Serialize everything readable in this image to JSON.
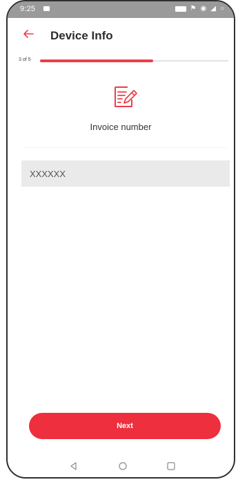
{
  "status_bar": {
    "time": "9:25"
  },
  "header": {
    "title": "Device Info"
  },
  "progress": {
    "label": "3 of 5",
    "fraction": 0.6
  },
  "section": {
    "label": "Invoice number"
  },
  "invoice_input": {
    "value": "XXXXXX"
  },
  "actions": {
    "next_label": "Next"
  },
  "colors": {
    "accent": "#ee2f3e",
    "input_bg": "#eaeaea",
    "status_bar_bg": "#9a9a9a"
  },
  "icons": {
    "back": "arrow-left",
    "section": "document-edit",
    "nav": [
      "triangle-back",
      "circle-home",
      "square-recents"
    ]
  }
}
